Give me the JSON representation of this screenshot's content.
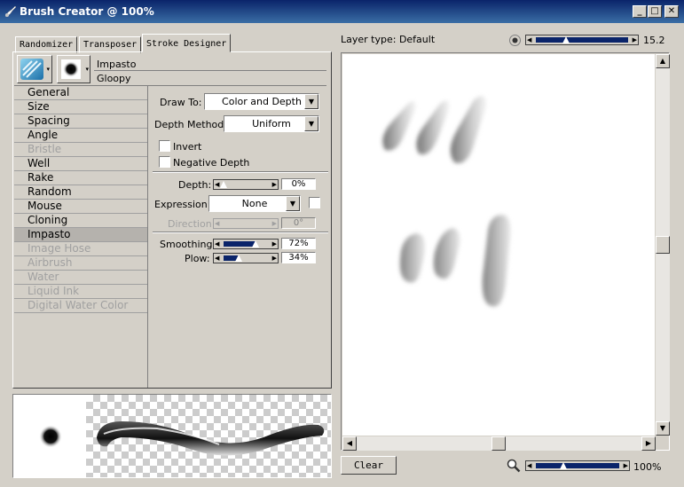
{
  "window": {
    "title": "Brush Creator @ 100%",
    "minimize": "_",
    "maximize": "□",
    "close": "✕"
  },
  "tabs": [
    {
      "label": "Randomizer"
    },
    {
      "label": "Transposer"
    },
    {
      "label": "Stroke Designer"
    }
  ],
  "brush": {
    "category": "Impasto",
    "variant": "Gloopy"
  },
  "sections": [
    {
      "label": "General",
      "state": "enabled"
    },
    {
      "label": "Size",
      "state": "enabled"
    },
    {
      "label": "Spacing",
      "state": "enabled"
    },
    {
      "label": "Angle",
      "state": "enabled"
    },
    {
      "label": "Bristle",
      "state": "disabled"
    },
    {
      "label": "Well",
      "state": "enabled"
    },
    {
      "label": "Rake",
      "state": "enabled"
    },
    {
      "label": "Random",
      "state": "enabled"
    },
    {
      "label": "Mouse",
      "state": "enabled"
    },
    {
      "label": "Cloning",
      "state": "enabled"
    },
    {
      "label": "Impasto",
      "state": "selected"
    },
    {
      "label": "Image Hose",
      "state": "disabled"
    },
    {
      "label": "Airbrush",
      "state": "disabled"
    },
    {
      "label": "Water",
      "state": "disabled"
    },
    {
      "label": "Liquid Ink",
      "state": "disabled"
    },
    {
      "label": "Digital Water Color",
      "state": "disabled"
    }
  ],
  "impasto": {
    "draw_to_label": "Draw To:",
    "draw_to_value": "Color and Depth",
    "depth_method_label": "Depth Method:",
    "depth_method_value": "Uniform",
    "invert_label": "Invert",
    "invert_checked": false,
    "negative_depth_label": "Negative Depth",
    "negative_depth_checked": false,
    "depth_label": "Depth:",
    "depth_value": "0%",
    "depth_fraction": 0.0,
    "expression_label": "Expression:",
    "expression_value": "None",
    "expression_invert_checked": false,
    "direction_label": "Direction:",
    "direction_value": "0°",
    "smoothing_label": "Smoothing:",
    "smoothing_value": "72%",
    "smoothing_fraction": 0.72,
    "plow_label": "Plow:",
    "plow_value": "34%",
    "plow_fraction": 0.34
  },
  "canvas": {
    "layer_type": "Layer type: Default",
    "brush_size": "15.2",
    "brush_size_fraction": 0.33,
    "clear_label": "Clear",
    "zoom": "100%",
    "zoom_fraction": 0.33
  },
  "icons": {
    "app": "paint-brush-icon",
    "category": "impasto-category-icon",
    "variant": "brush-dab-icon",
    "size": "brush-size-dot-icon",
    "zoom": "magnifier-icon"
  }
}
